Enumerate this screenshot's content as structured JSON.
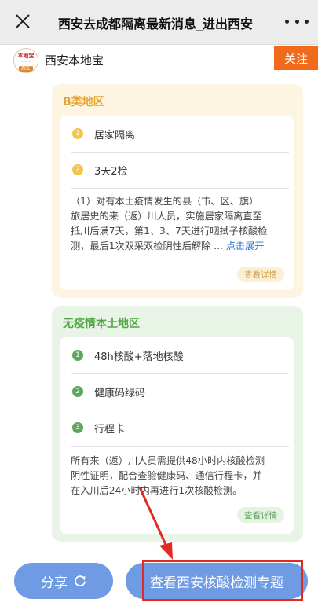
{
  "header": {
    "title": "西安去成都隔离最新消息_进出西安",
    "close_icon": "close-icon",
    "more_icon": "more-dots-icon"
  },
  "account": {
    "logo_text_top": "本地宝",
    "logo_text_bottom": "西安",
    "name": "西安本地宝",
    "follow_label": "关注",
    "follow_color": "#f26a1b"
  },
  "region_b": {
    "title": "B类地区",
    "accent": "#e6a532",
    "items": [
      {
        "num": "1",
        "text": "居家隔离"
      },
      {
        "num": "2",
        "text": "3天2检"
      }
    ],
    "paragraph_lines": [
      "（1）对有本土疫情发生的县（市、区、旗）",
      "旅居史的来（返）川人员，实施居家隔离直至",
      "抵川后满7天，第1、3、7天进行咽拭子核酸检",
      "测，最后1次双采双检阴性后解除 ... "
    ],
    "expand_label": "点击展开",
    "detail_label": "查看详情"
  },
  "region_none": {
    "title": "无疫情本土地区",
    "accent": "#55a849",
    "items": [
      {
        "num": "1",
        "text": "48h核酸+落地核酸"
      },
      {
        "num": "2",
        "text": "健康码绿码"
      },
      {
        "num": "3",
        "text": "行程卡"
      }
    ],
    "paragraph_lines": [
      "所有来（返）川人员需提供48小时内核酸检测",
      "阴性证明，配合查验健康码、通信行程卡，并",
      "在入川后24小时内再进行1次核酸检测。"
    ],
    "detail_label": "查看详情"
  },
  "bottom": {
    "share_label": "分享",
    "share_icon": "refresh-share-icon",
    "topic_label": "查看西安核酸检测专题",
    "button_color": "#6f9ae4",
    "highlight_color": "#e02a24"
  }
}
